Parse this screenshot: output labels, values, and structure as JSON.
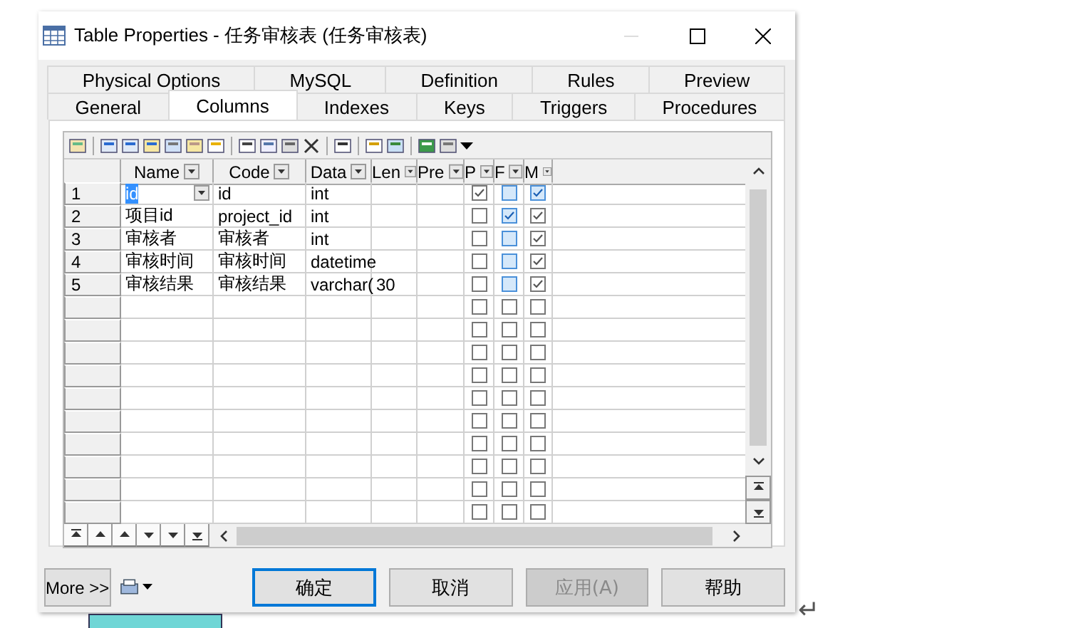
{
  "window": {
    "title": "Table Properties - 任务审核表 (任务审核表)"
  },
  "tab_rows": [
    {
      "tabs": [
        {
          "label": "Physical Options",
          "selected": false
        },
        {
          "label": "MySQL",
          "selected": false
        },
        {
          "label": "Definition",
          "selected": false
        },
        {
          "label": "Rules",
          "selected": false
        },
        {
          "label": "Preview",
          "selected": false
        }
      ]
    },
    {
      "tabs": [
        {
          "label": "General",
          "selected": false
        },
        {
          "label": "Columns",
          "selected": true
        },
        {
          "label": "Indexes",
          "selected": false
        },
        {
          "label": "Keys",
          "selected": false
        },
        {
          "label": "Triggers",
          "selected": false
        },
        {
          "label": "Procedures",
          "selected": false
        }
      ]
    }
  ],
  "grid": {
    "columns": [
      {
        "label": "Name"
      },
      {
        "label": "Code"
      },
      {
        "label": "Data"
      },
      {
        "label": "Len"
      },
      {
        "label": "Pre"
      },
      {
        "label": "P"
      },
      {
        "label": "F"
      },
      {
        "label": "M"
      }
    ],
    "rows": [
      {
        "number": "1",
        "name": "id",
        "code": "id",
        "data_type": "int",
        "editing": true,
        "checks": [
          {
            "checked": true,
            "highlighted": false
          },
          {
            "checked": false,
            "highlighted": true
          },
          {
            "checked": true,
            "highlighted": true
          }
        ]
      },
      {
        "number": "2",
        "name": "项目id",
        "code": "project_id",
        "data_type": "int",
        "editing": false,
        "checks": [
          {
            "checked": false,
            "highlighted": false
          },
          {
            "checked": true,
            "highlighted": true
          },
          {
            "checked": true,
            "highlighted": false
          }
        ]
      },
      {
        "number": "3",
        "name": "审核者",
        "code": "审核者",
        "data_type": "int",
        "editing": false,
        "checks": [
          {
            "checked": false,
            "highlighted": false
          },
          {
            "checked": false,
            "highlighted": true
          },
          {
            "checked": true,
            "highlighted": false
          }
        ]
      },
      {
        "number": "4",
        "name": "审核时间",
        "code": "审核时间",
        "data_type": "datetime",
        "editing": false,
        "checks": [
          {
            "checked": false,
            "highlighted": false
          },
          {
            "checked": false,
            "highlighted": true
          },
          {
            "checked": true,
            "highlighted": false
          }
        ]
      },
      {
        "number": "5",
        "name": "审核结果",
        "code": "审核结果",
        "data_type": "varchar(",
        "length": "30",
        "editing": false,
        "checks": [
          {
            "checked": false,
            "highlighted": false
          },
          {
            "checked": false,
            "highlighted": true
          },
          {
            "checked": true,
            "highlighted": false
          }
        ]
      }
    ],
    "blank_rows": [
      {
        "checks": [
          false,
          false,
          false
        ]
      },
      {
        "checks": [
          false,
          false,
          false
        ]
      },
      {
        "checks": [
          false,
          false,
          false
        ]
      },
      {
        "checks": [
          false,
          false,
          false
        ]
      },
      {
        "checks": [
          false,
          false,
          false
        ]
      },
      {
        "checks": [
          false,
          false,
          false
        ]
      },
      {
        "checks": [
          false,
          false,
          false
        ]
      },
      {
        "checks": [
          false,
          false,
          false
        ]
      },
      {
        "checks": [
          false,
          false,
          false
        ]
      },
      {
        "checks": [
          false,
          false,
          false
        ]
      }
    ]
  },
  "more_button": {
    "label": "More >>"
  },
  "buttons": [
    {
      "label": "确定",
      "focused": true,
      "disabled": false
    },
    {
      "label": "取消",
      "focused": false,
      "disabled": false
    },
    {
      "label": "应用(A)",
      "focused": false,
      "disabled": true
    },
    {
      "label": "帮助",
      "focused": false,
      "disabled": false
    }
  ],
  "return_mark": "↵"
}
